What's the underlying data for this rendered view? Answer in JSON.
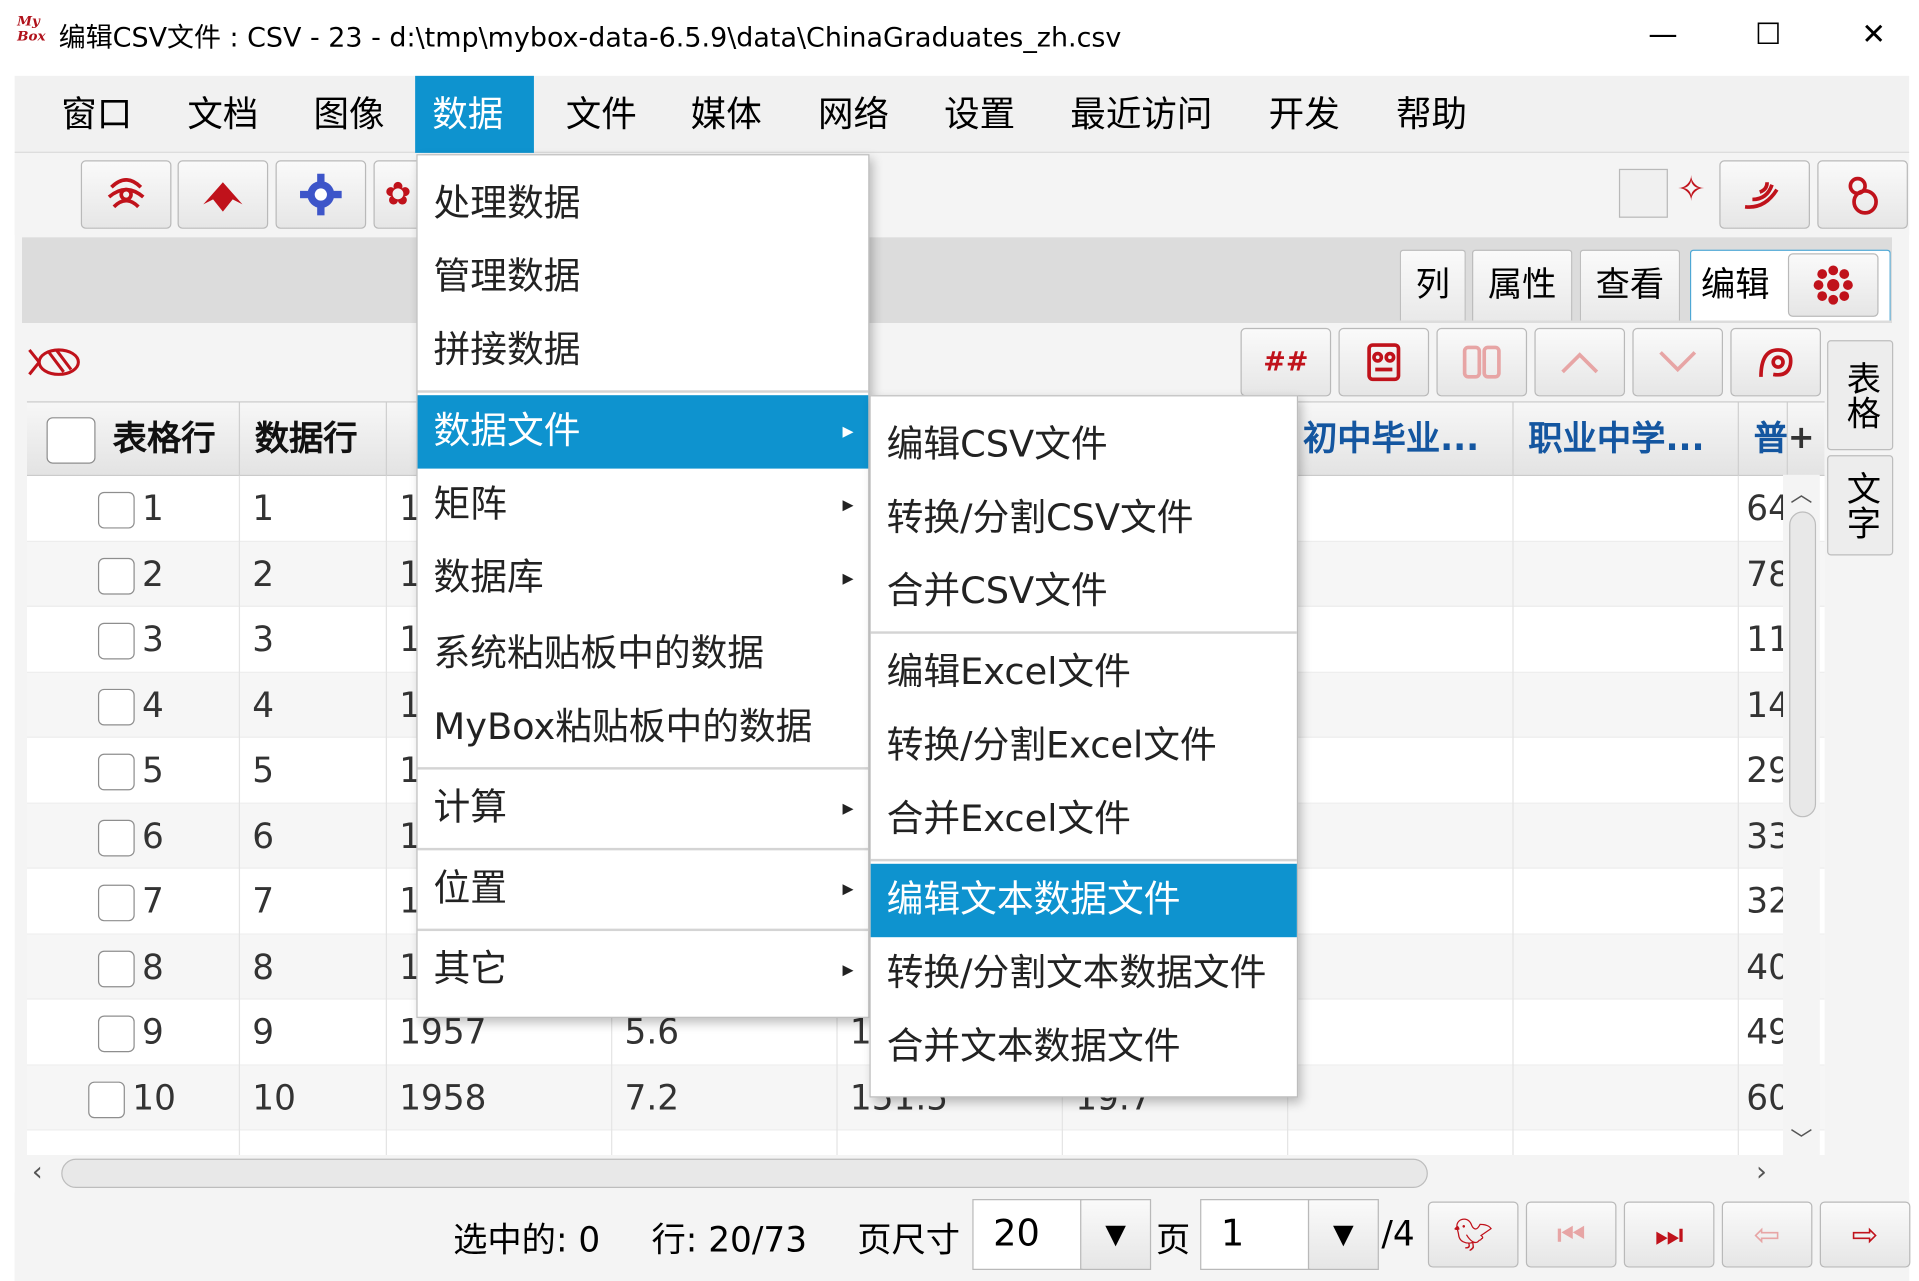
{
  "window": {
    "logo_text": "My Box",
    "title": "编辑CSV文件 : CSV - 23 - d:\\tmp\\mybox-data-6.5.9\\data\\ChinaGraduates_zh.csv",
    "minimize": "—",
    "maximize": "☐",
    "close": "✕"
  },
  "menubar": {
    "items": [
      "窗口",
      "文档",
      "图像",
      "数据",
      "文件",
      "媒体",
      "网络",
      "设置",
      "最近访问",
      "开发",
      "帮助"
    ],
    "active_index": 3
  },
  "tabs": {
    "items": [
      "列",
      "属性",
      "查看",
      "编辑"
    ],
    "selected": "编辑"
  },
  "side_tabs": [
    "表格",
    "文字"
  ],
  "toolbar2": {
    "hash_label": "##"
  },
  "table": {
    "headers": [
      "表格行",
      "数据行",
      "",
      "",
      "",
      "",
      "初中毕业...",
      "职业中学...",
      "普"
    ],
    "add_column": "+",
    "rows": [
      {
        "row": "1",
        "data": "1",
        "c1": "1",
        "c2": "",
        "c3": "",
        "c4": "",
        "last": "64"
      },
      {
        "row": "2",
        "data": "2",
        "c1": "1",
        "c2": "",
        "c3": "",
        "c4": "",
        "last": "78"
      },
      {
        "row": "3",
        "data": "3",
        "c1": "1",
        "c2": "",
        "c3": "",
        "c4": "",
        "last": "11"
      },
      {
        "row": "4",
        "data": "4",
        "c1": "1",
        "c2": "",
        "c3": "",
        "c4": "",
        "last": "14"
      },
      {
        "row": "5",
        "data": "5",
        "c1": "1",
        "c2": "",
        "c3": "",
        "c4": "",
        "last": "29"
      },
      {
        "row": "6",
        "data": "6",
        "c1": "1",
        "c2": "",
        "c3": "",
        "c4": "",
        "last": "33"
      },
      {
        "row": "7",
        "data": "7",
        "c1": "1",
        "c2": "",
        "c3": "",
        "c4": "",
        "last": "32"
      },
      {
        "row": "8",
        "data": "8",
        "c1": "1",
        "c2": "",
        "c3": "",
        "c4": "",
        "last": "40"
      },
      {
        "row": "9",
        "data": "9",
        "c1": "1957",
        "c2": "5.6",
        "c3": "1",
        "c4": "",
        "last": "49"
      },
      {
        "row": "10",
        "data": "10",
        "c1": "1958",
        "c2": "7.2",
        "c3": "151.5",
        "c4": "19.7",
        "last": "60"
      }
    ]
  },
  "data_menu": {
    "items": [
      {
        "label": "处理数据",
        "arrow": ""
      },
      {
        "label": "管理数据",
        "arrow": ""
      },
      {
        "label": "拼接数据",
        "arrow": ""
      },
      {
        "label": "数据文件",
        "arrow": "▸"
      },
      {
        "label": "矩阵",
        "arrow": "▸"
      },
      {
        "label": "数据库",
        "arrow": "▸"
      },
      {
        "label": "系统粘贴板中的数据",
        "arrow": ""
      },
      {
        "label": "MyBox粘贴板中的数据",
        "arrow": ""
      },
      {
        "label": "计算",
        "arrow": "▸"
      },
      {
        "label": "位置",
        "arrow": "▸"
      },
      {
        "label": "其它",
        "arrow": "▸"
      }
    ],
    "highlighted": "数据文件"
  },
  "file_submenu": {
    "items": [
      "编辑CSV文件",
      "转换/分割CSV文件",
      "合并CSV文件",
      "编辑Excel文件",
      "转换/分割Excel文件",
      "合并Excel文件",
      "编辑文本数据文件",
      "转换/分割文本数据文件",
      "合并文本数据文件"
    ],
    "highlighted": "编辑文本数据文件"
  },
  "status": {
    "selected": "选中的: 0",
    "rows": "行: 20/73",
    "page_size_label": "页尺寸",
    "page_size": "20",
    "page_label": "页",
    "page": "1",
    "total_pages": "/4",
    "drop": "▼"
  },
  "colors": {
    "accent": "#0e93cf",
    "icon_red": "#c0121b",
    "header_blue": "#1456a0"
  }
}
